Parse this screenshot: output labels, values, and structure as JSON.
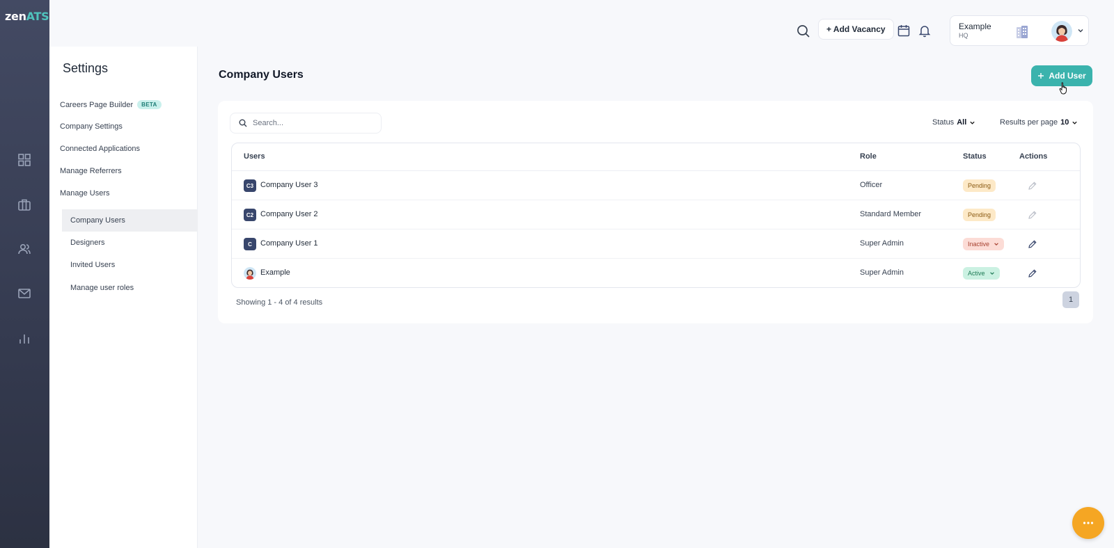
{
  "app": {
    "logo_main": "zen",
    "logo_accent": "ATS"
  },
  "rail": {
    "icons": [
      "dashboard-icon",
      "briefcase-icon",
      "users-icon",
      "mail-icon",
      "chart-icon"
    ]
  },
  "header": {
    "add_vacancy_label": "+ Add Vacancy",
    "account_name": "Example",
    "account_location": "HQ"
  },
  "settings": {
    "title": "Settings",
    "items": {
      "careers_page_builder": "Careers Page Builder",
      "beta_badge": "BETA",
      "company_settings": "Company Settings",
      "connected_applications": "Connected Applications",
      "manage_referrers": "Manage Referrers",
      "manage_users": "Manage Users"
    },
    "sub_items": {
      "company_users": "Company Users",
      "designers": "Designers",
      "invited_users": "Invited Users",
      "manage_user_roles": "Manage user roles"
    }
  },
  "main": {
    "title": "Company Users",
    "add_user_label": "Add User",
    "search_placeholder": "Search...",
    "status_filter_label": "Status",
    "status_filter_value": "All",
    "results_label": "Results per page",
    "results_value": "10",
    "columns": {
      "users": "Users",
      "role": "Role",
      "status": "Status",
      "actions": "Actions"
    },
    "rows": [
      {
        "initials": "C3",
        "name": "Company User 3",
        "role": "Officer",
        "status": "Pending"
      },
      {
        "initials": "C2",
        "name": "Company User 2",
        "role": "Standard Member",
        "status": "Pending"
      },
      {
        "initials": "C",
        "name": "Company User 1",
        "role": "Super Admin",
        "status": "Inactive"
      },
      {
        "initials": "",
        "name": "Example",
        "role": "Super Admin",
        "status": "Active"
      }
    ],
    "showing": "Showing 1 - 4 of 4 results",
    "page": "1"
  },
  "colors": {
    "accent": "#3bb3ad",
    "rail": "#353b50",
    "chat": "#f5a623"
  }
}
